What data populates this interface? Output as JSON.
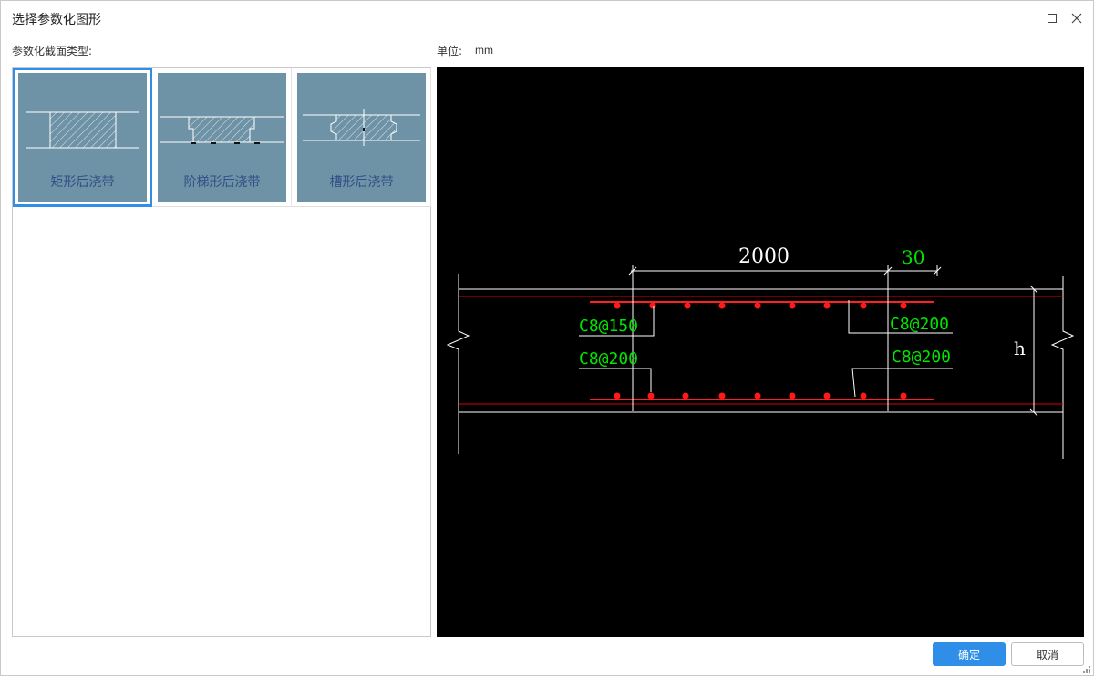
{
  "window": {
    "title": "选择参数化图形"
  },
  "labels": {
    "section_type": "参数化截面类型:",
    "unit_label": "单位:",
    "unit_value": "mm"
  },
  "thumbnails": [
    {
      "caption": "矩形后浇带",
      "selected": true
    },
    {
      "caption": "阶梯形后浇带",
      "selected": false
    },
    {
      "caption": "槽形后浇带",
      "selected": false
    }
  ],
  "drawing": {
    "width_dim": "2000",
    "offset_dim": "30",
    "height_label": "h",
    "rebar_labels": {
      "top_left": "C8@150",
      "bottom_left": "C8@200",
      "top_right": "C8@200",
      "bottom_right": "C8@200"
    },
    "colors": {
      "background": "#000000",
      "lines": "#ffffff",
      "rebar": "#ff0000",
      "labels": "#00e600"
    }
  },
  "buttons": {
    "ok": "确定",
    "cancel": "取消"
  }
}
